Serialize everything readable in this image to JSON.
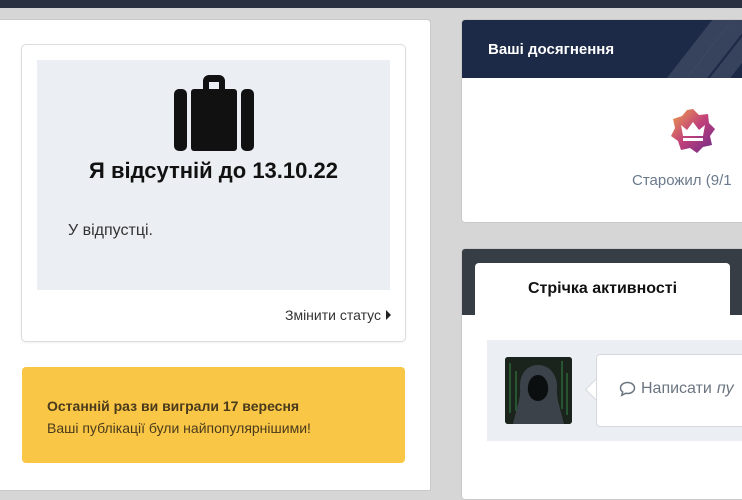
{
  "away": {
    "title": "Я відсутній до 13.10.22",
    "note": "У відпустці.",
    "change_status": "Змінити статус",
    "icon": "suitcase-icon"
  },
  "banner": {
    "title": "Останній раз ви виграли 17 вересня",
    "subtitle": "Ваші публікації були найпопулярнішими!",
    "color": "#f9c646"
  },
  "achievements": {
    "title": "Ваші досягнення",
    "rank": "Старожил (9/1",
    "badge_icon": "crown-badge-icon",
    "header_color": "#1c2947"
  },
  "activity": {
    "tab_label": "Стрічка активності",
    "compose_prefix": "Написати",
    "compose_suffix": "пу",
    "compose_icon": "speech-bubble-icon",
    "header_color": "#373d44"
  }
}
